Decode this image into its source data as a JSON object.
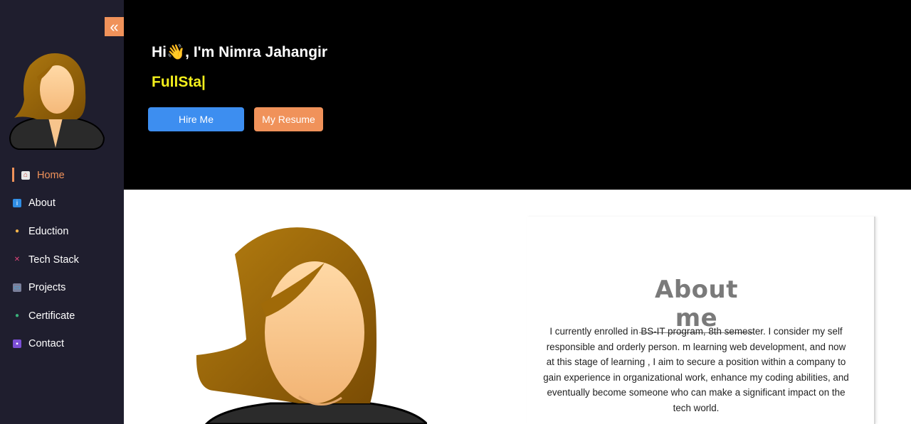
{
  "sidebar": {
    "collapse_icon": "double-chevron-left-icon",
    "items": [
      {
        "label": "Home",
        "icon": "house-icon",
        "active": true
      },
      {
        "label": "About",
        "icon": "info-icon",
        "active": false
      },
      {
        "label": "Eduction",
        "icon": "student-icon",
        "active": false
      },
      {
        "label": "Tech Stack",
        "icon": "tools-icon",
        "active": false
      },
      {
        "label": "Projects",
        "icon": "projector-icon",
        "active": false
      },
      {
        "label": "Certificate",
        "icon": "graduate-icon",
        "active": false
      },
      {
        "label": "Contact",
        "icon": "contact-icon",
        "active": false
      }
    ]
  },
  "hero": {
    "greeting": "Hi👋, I'm Nimra Jahangir",
    "typed_text": "FullSta|",
    "hire_label": "Hire Me",
    "resume_label": "My Resume"
  },
  "about": {
    "title": "About me",
    "text": "I currently enrolled in BS-IT program, 8th semester. I consider my self responsible and orderly person. m learning web development, and now at this stage of learning , I aim to secure a position within a company to gain experience in organizational work, enhance my coding abilities, and eventually become someone who can make a significant impact on the tech world."
  },
  "colors": {
    "sidebar_bg": "#1f1e2e",
    "accent": "#f0925a",
    "hero_bg": "#000000",
    "typed": "#f2ee1c",
    "hire_btn": "#3d8ef0"
  }
}
